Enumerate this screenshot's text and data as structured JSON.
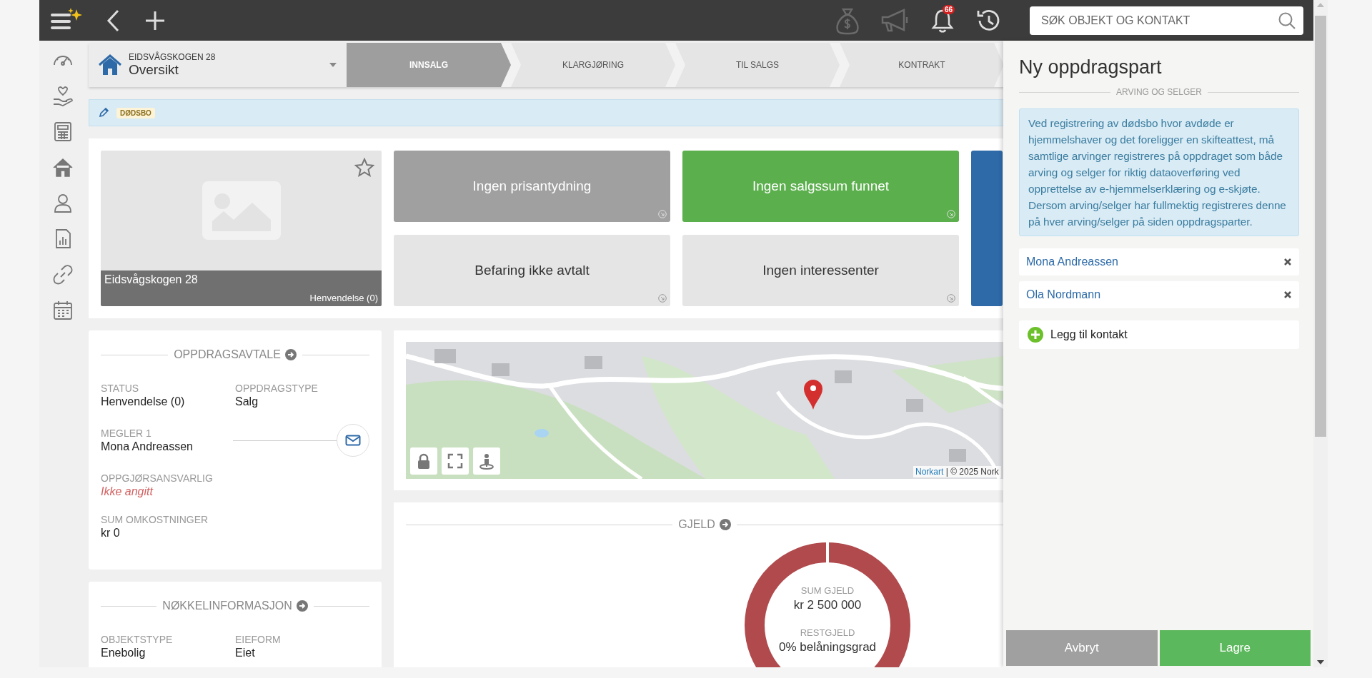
{
  "topbar": {
    "notification_count": "66",
    "search": {
      "placeholder": "SØK OBJEKT OG KONTAKT"
    }
  },
  "header": {
    "address": "EIDSVÅGSKOGEN 28",
    "page": "Oversikt",
    "steps": [
      {
        "label": "INNSALG",
        "selected": true
      },
      {
        "label": "KLARGJØRING",
        "selected": false
      },
      {
        "label": "TIL SALGS",
        "selected": false
      },
      {
        "label": "KONTRAKT",
        "selected": false
      }
    ]
  },
  "tags": [
    "DØDSBO"
  ],
  "property": {
    "title": "Eidsvågskogen 28",
    "status": "Henvendelse (0)",
    "favorite": false
  },
  "tiles": [
    {
      "kind": "gray",
      "label": "Ingen prisantydning"
    },
    {
      "kind": "green",
      "label": "Ingen salgssum funnet"
    },
    {
      "kind": "blue"
    },
    {
      "kind": "light",
      "label": "Befaring ikke avtalt"
    },
    {
      "kind": "light",
      "label": "Ingen interessenter"
    }
  ],
  "agreement": {
    "title": "OPPDRAGSAVTALE",
    "rows": [
      {
        "kind": "pair",
        "fields": [
          {
            "label": "STATUS",
            "value": "Henvendelse (0)",
            "missing": false
          },
          {
            "label": "OPPDRAGSTYPE",
            "value": "Salg",
            "missing": false
          }
        ]
      },
      {
        "kind": "contact",
        "fields": [
          {
            "label": "MEGLER 1",
            "value": "Mona Andreassen",
            "missing": false
          }
        ]
      },
      {
        "kind": "pair",
        "fields": [
          {
            "label": "OPPGJØRSANSVARLIG",
            "value": "Ikke angitt",
            "missing": true
          }
        ]
      },
      {
        "kind": "pair",
        "fields": [
          {
            "label": "SUM OMKOSTNINGER",
            "value": "kr 0",
            "missing": false
          }
        ]
      }
    ]
  },
  "key_info": {
    "title": "NØKKELINFORMASJON",
    "rows": [
      {
        "kind": "pair",
        "fields": [
          {
            "label": "OBJEKTSTYPE",
            "value": "Enebolig",
            "missing": false
          },
          {
            "label": "EIEFORM",
            "value": "Eiet",
            "missing": false
          }
        ]
      }
    ]
  },
  "map": {
    "attribution_link": "Norkart",
    "attribution": "| © 2025 Nork"
  },
  "debt": {
    "title": "GJELD",
    "sum_label": "SUM GJELD",
    "sum": "kr 2 500 000",
    "rest_label": "RESTGJELD",
    "rest": "0% belåningsgrad"
  },
  "panel": {
    "title": "Ny oppdragspart",
    "section": "ARVING OG SELGER",
    "notice": "Ved registrering av dødsbo hvor avdøde er hjemmelshaver og det foreligger en skifteattest, må samtlige arvinger registreres på oppdraget som både arving og selger for riktig dataoverføring ved opprettelse av e-hjemmelserklæring og e-skjøte. Dersom arving/selger har fullmektig registreres denne på hver arving/selger på siden oppdragsparter.",
    "contacts": [
      {
        "name": "Mona Andreassen"
      },
      {
        "name": "Ola Nordmann"
      }
    ],
    "add_contact": "Legg til kontakt",
    "buttons": [
      {
        "kind": "cancel",
        "label": "Avbryt"
      },
      {
        "kind": "save",
        "label": "Lagre"
      }
    ]
  }
}
